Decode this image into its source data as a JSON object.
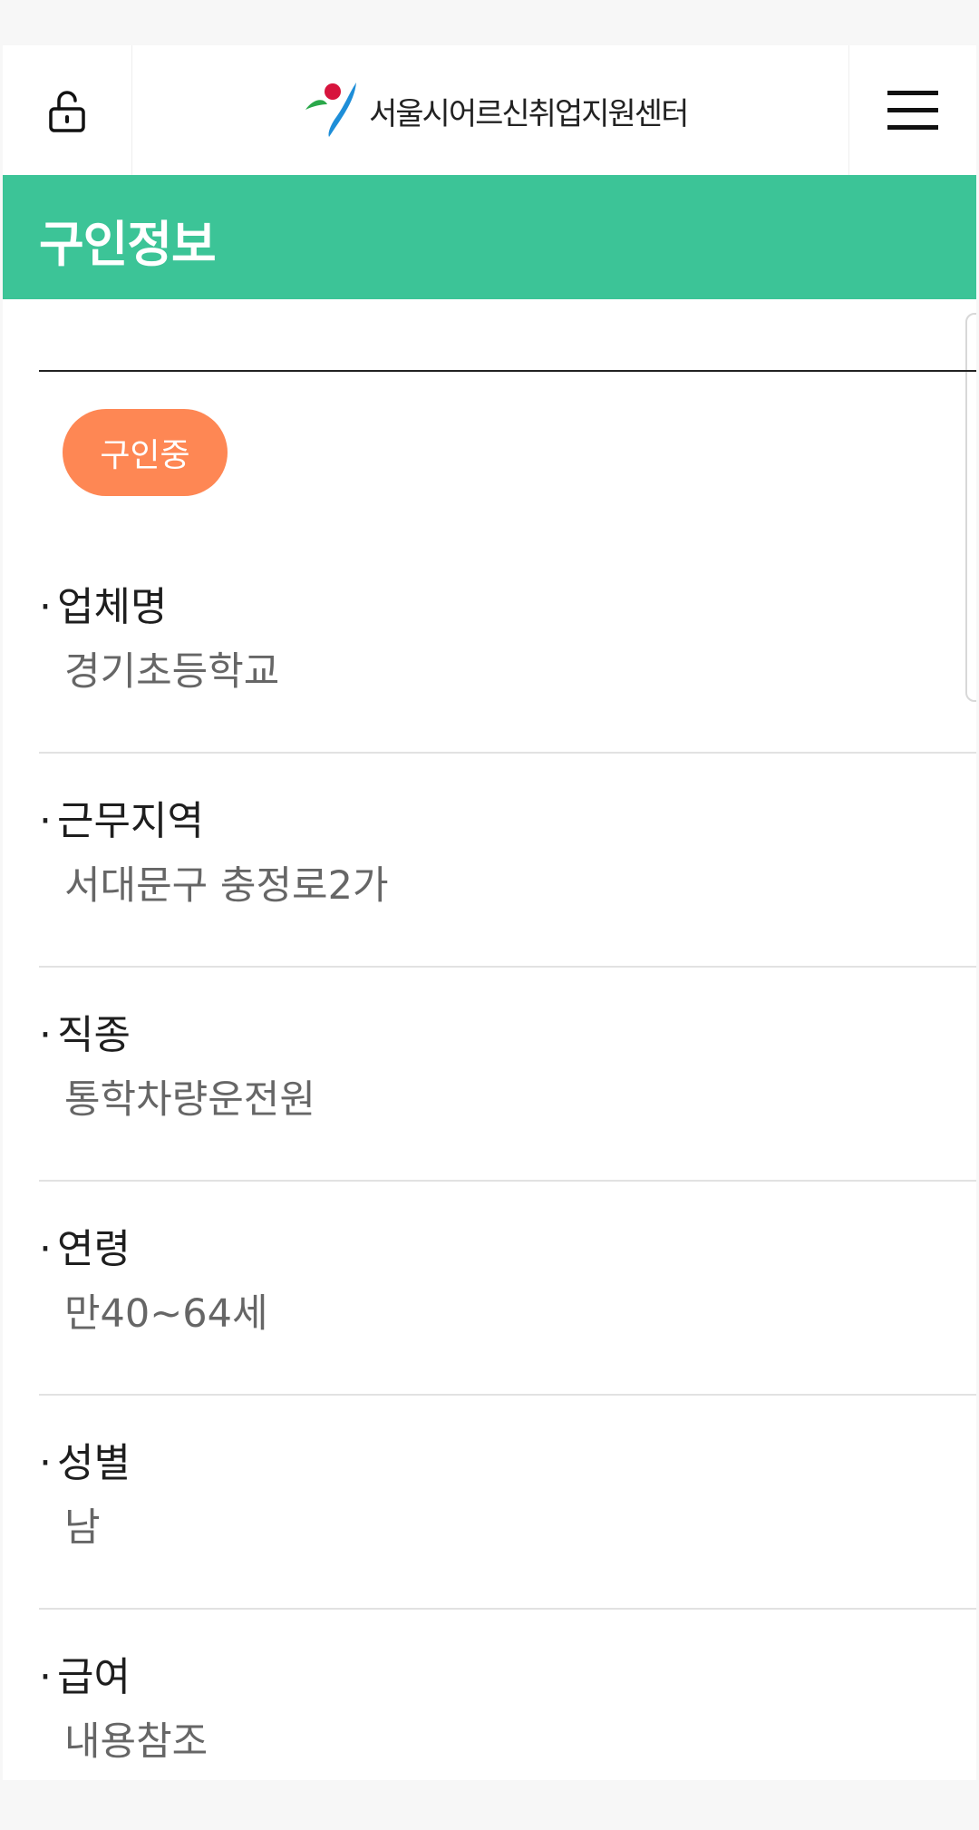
{
  "header": {
    "logo_text": "서울시어르신취업지원센터",
    "lock_icon": "lock-open-icon",
    "menu_icon": "hamburger-menu-icon"
  },
  "banner": {
    "title": "구인정보",
    "color": "#3cc497"
  },
  "status_badge": {
    "label": "구인중",
    "color": "#fe8754"
  },
  "fields": [
    {
      "label": "업체명",
      "value": "경기초등학교"
    },
    {
      "label": "근무지역",
      "value": "서대문구 충정로2가"
    },
    {
      "label": "직종",
      "value": "통학차량운전원"
    },
    {
      "label": "연령",
      "value": "만40~64세"
    },
    {
      "label": "성별",
      "value": "남"
    },
    {
      "label": "급여",
      "value": "내용참조"
    }
  ]
}
